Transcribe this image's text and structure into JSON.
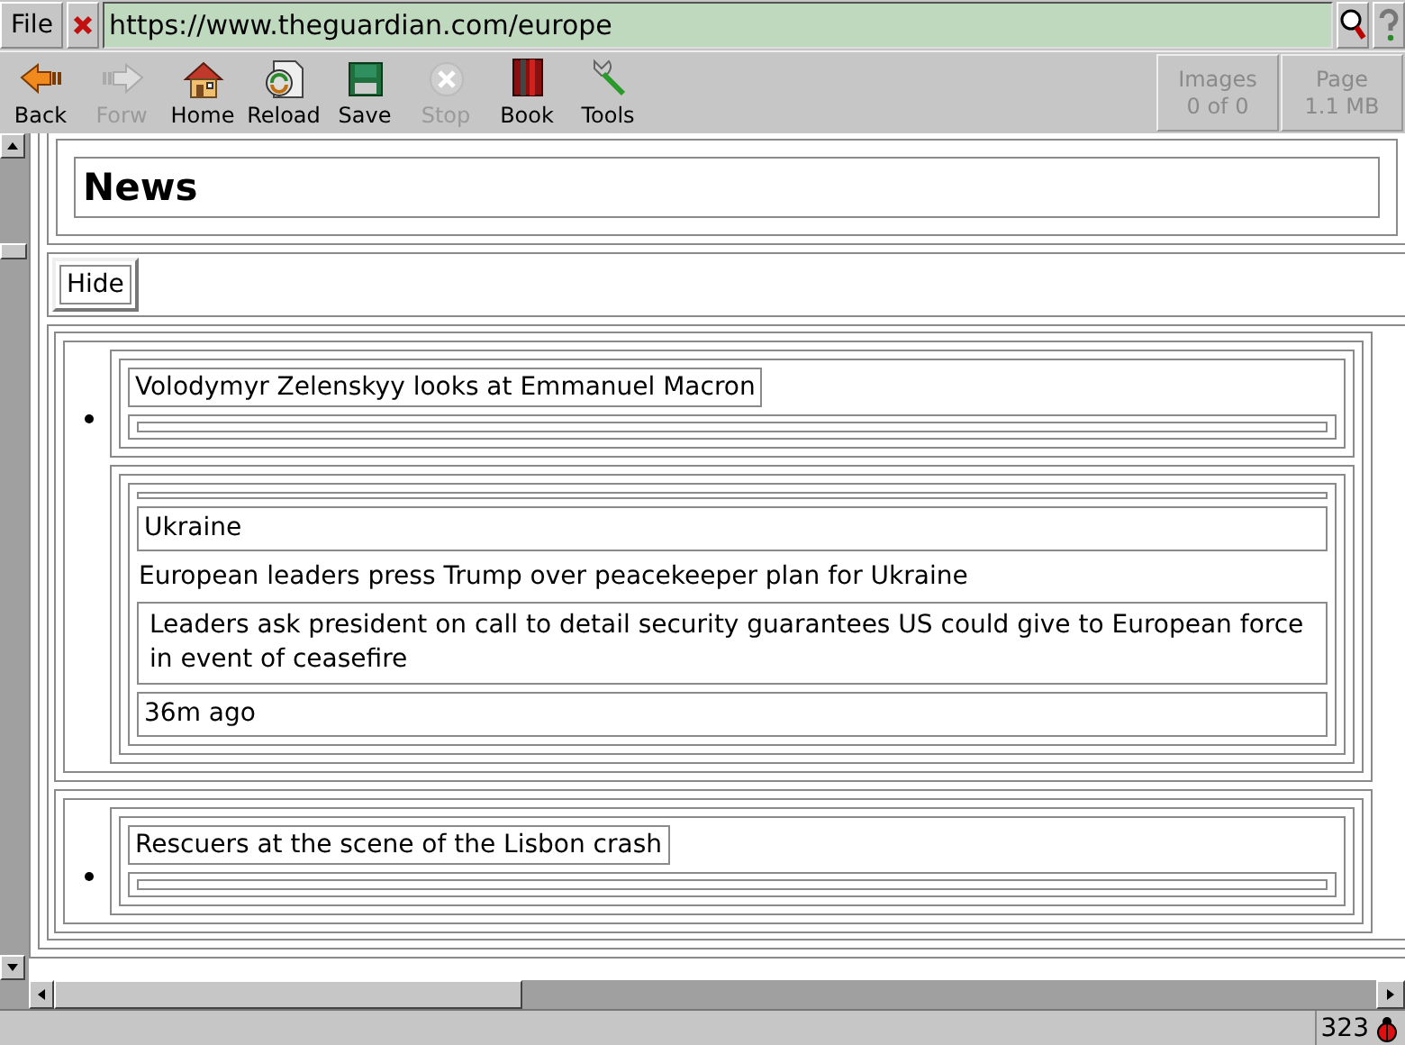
{
  "location_bar": {
    "file_menu": "File",
    "url": "https://www.theguardian.com/europe"
  },
  "toolbar": {
    "buttons": [
      {
        "kind": "back",
        "label": "Back",
        "disabled": false
      },
      {
        "kind": "forward",
        "label": "Forw",
        "disabled": true
      },
      {
        "kind": "home",
        "label": "Home",
        "disabled": false
      },
      {
        "kind": "reload",
        "label": "Reload",
        "disabled": false
      },
      {
        "kind": "save",
        "label": "Save",
        "disabled": false
      },
      {
        "kind": "stop",
        "label": "Stop",
        "disabled": true
      },
      {
        "kind": "bookmarks",
        "label": "Book",
        "disabled": false
      },
      {
        "kind": "tools",
        "label": "Tools",
        "disabled": false
      }
    ],
    "images": {
      "label": "Images",
      "value": "0 of 0"
    },
    "page": {
      "label": "Page",
      "value": "1.1 MB"
    }
  },
  "content": {
    "heading": "News",
    "hide_button": "Hide",
    "articles": [
      {
        "image_alt": "Volodymyr Zelenskyy looks at Emmanuel Macron",
        "kicker": "Ukraine",
        "headline": "European leaders press Trump over peacekeeper plan for Ukraine",
        "standfirst": "Leaders ask president on call to detail security guarantees US could give to European force in event of ceasefire",
        "time": "36m ago"
      },
      {
        "image_alt": "Rescuers at the scene of the Lisbon crash"
      }
    ]
  },
  "status_bar": {
    "count": "323"
  }
}
